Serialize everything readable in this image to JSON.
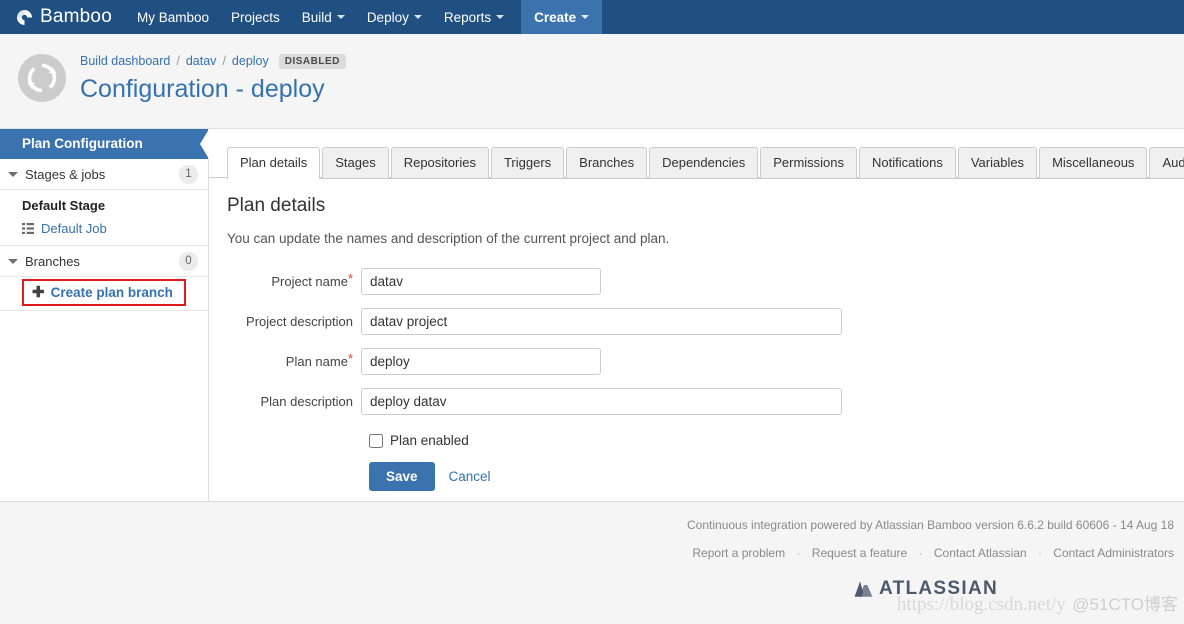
{
  "topnav": {
    "brand": "Bamboo",
    "brand_icon": "bamboo-logo-icon",
    "items": [
      {
        "label": "My Bamboo",
        "has_caret": false,
        "name": "nav-my-bamboo"
      },
      {
        "label": "Projects",
        "has_caret": false,
        "name": "nav-projects"
      },
      {
        "label": "Build",
        "has_caret": true,
        "name": "nav-build"
      },
      {
        "label": "Deploy",
        "has_caret": true,
        "name": "nav-deploy"
      },
      {
        "label": "Reports",
        "has_caret": true,
        "name": "nav-reports"
      }
    ],
    "create": {
      "label": "Create",
      "has_caret": true
    },
    "background": "#205081",
    "create_background": "#3b73af"
  },
  "header": {
    "avatar_icon": "sync-circle-icon",
    "breadcrumb": [
      {
        "label": "Build dashboard",
        "link": true
      },
      {
        "label": "datav",
        "link": true
      },
      {
        "label": "deploy",
        "link": true
      }
    ],
    "separator": "/",
    "status_badge": "DISABLED",
    "title": "Configuration - deploy",
    "title_color": "#3572b0"
  },
  "sidebar": {
    "header": "Plan Configuration",
    "header_background": "#3b73af",
    "groups": [
      {
        "label": "Stages & jobs",
        "count": "1"
      },
      {
        "label": "Branches",
        "count": "0"
      }
    ],
    "stage": "Default Stage",
    "job": "Default Job",
    "job_icon": "list-icon",
    "create_branch": {
      "label": "Create plan branch",
      "icon": "plus-icon",
      "highlight_color": "#e01b1b"
    }
  },
  "tabs": [
    {
      "label": "Plan details",
      "active": true
    },
    {
      "label": "Stages",
      "active": false
    },
    {
      "label": "Repositories",
      "active": false
    },
    {
      "label": "Triggers",
      "active": false
    },
    {
      "label": "Branches",
      "active": false
    },
    {
      "label": "Dependencies",
      "active": false
    },
    {
      "label": "Permissions",
      "active": false
    },
    {
      "label": "Notifications",
      "active": false
    },
    {
      "label": "Variables",
      "active": false
    },
    {
      "label": "Miscellaneous",
      "active": false
    },
    {
      "label": "Audit log",
      "active": false
    }
  ],
  "main": {
    "section_title": "Plan details",
    "section_description": "You can update the names and description of the current project and plan.",
    "fields": [
      {
        "label": "Project name",
        "required": true,
        "value": "datav",
        "placeholder": "",
        "width": "short"
      },
      {
        "label": "Project description",
        "required": false,
        "value": "datav project",
        "placeholder": "",
        "width": "long"
      },
      {
        "label": "Plan name",
        "required": true,
        "value": "deploy",
        "placeholder": "",
        "width": "short"
      },
      {
        "label": "Plan description",
        "required": false,
        "value": "deploy datav",
        "placeholder": "",
        "width": "long"
      }
    ],
    "checkbox": {
      "label": "Plan enabled",
      "checked": false
    },
    "save_label": "Save",
    "cancel_label": "Cancel",
    "accent_color": "#3b73af"
  },
  "footer": {
    "version_text": "Continuous integration powered by Atlassian Bamboo version 6.6.2 build 60606 - 14 Aug 18",
    "links": [
      "Report a problem",
      "Request a feature",
      "Contact Atlassian",
      "Contact Administrators"
    ],
    "separator": "·",
    "logo_text": "ATLASSIAN",
    "logo_icon": "atlassian-mark-icon"
  },
  "watermark": {
    "url": "https://blog.csdn.net/y",
    "tag": "@51CTO博客"
  }
}
